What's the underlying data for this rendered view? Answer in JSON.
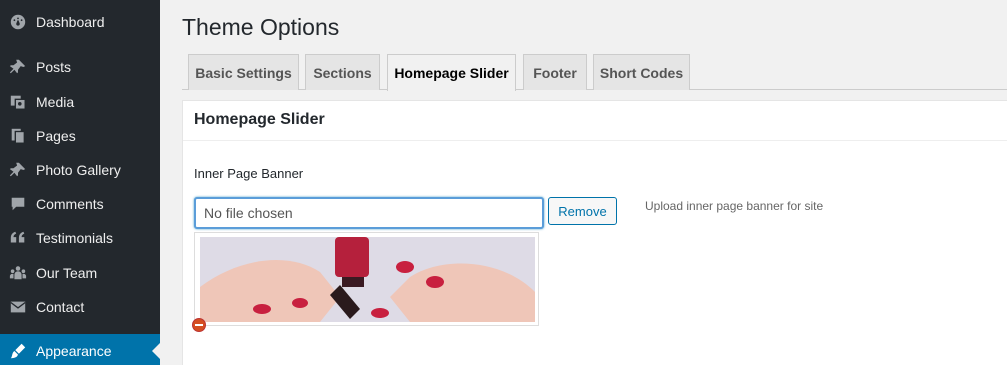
{
  "sidebar": {
    "items": [
      {
        "label": "Dashboard",
        "icon": "dashboard-icon"
      },
      {
        "label": "Posts",
        "icon": "pin-icon"
      },
      {
        "label": "Media",
        "icon": "media-icon"
      },
      {
        "label": "Pages",
        "icon": "pages-icon"
      },
      {
        "label": "Photo Gallery",
        "icon": "pin-icon"
      },
      {
        "label": "Comments",
        "icon": "comment-icon"
      },
      {
        "label": "Testimonials",
        "icon": "quote-icon"
      },
      {
        "label": "Our Team",
        "icon": "team-icon"
      },
      {
        "label": "Contact",
        "icon": "mail-icon"
      },
      {
        "label": "Appearance",
        "icon": "brush-icon",
        "active": true
      }
    ],
    "colors": {
      "background": "#23282d",
      "active": "#0073aa"
    }
  },
  "page": {
    "title": "Theme Options"
  },
  "tabs": [
    {
      "label": "Basic Settings"
    },
    {
      "label": "Sections"
    },
    {
      "label": "Homepage Slider",
      "active": true
    },
    {
      "label": "Footer"
    },
    {
      "label": "Short Codes"
    }
  ],
  "panel": {
    "title": "Homepage Slider",
    "field_label": "Inner Page Banner",
    "file_input_value": "No file chosen",
    "remove_button": "Remove",
    "description": "Upload inner page banner for site"
  }
}
